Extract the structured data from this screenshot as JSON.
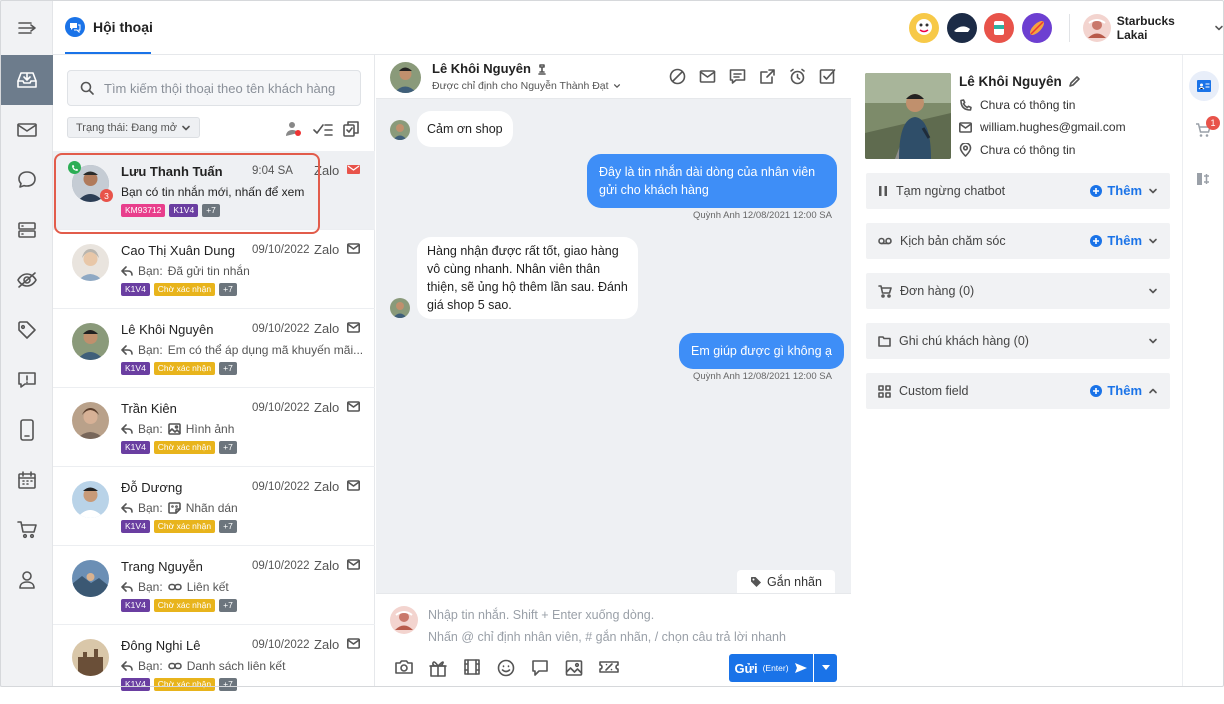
{
  "header": {
    "tab_label": "Hội thoại",
    "user_name": "Starbucks Lakai"
  },
  "search": {
    "placeholder": "Tìm kiếm thội thoại theo tên khách hàng"
  },
  "filter": {
    "label": "Trạng thái: Đang mở"
  },
  "conversations": [
    {
      "name": "Lưu Thanh Tuấn",
      "time": "9:04 SA",
      "channel": "Zalo",
      "preview": "Bạn có tin nhắn mới, nhấn để xem",
      "tags": [
        "KM93712",
        "K1V4",
        "+7"
      ],
      "badge": "3",
      "unread": true
    },
    {
      "name": "Cao Thị Xuân Dung",
      "time": "09/10/2022",
      "channel": "Zalo",
      "preview_prefix": "Bạn:",
      "preview": "Đã gửi tin nhắn",
      "tags": [
        "K1V4",
        "Chờ xác nhận",
        "+7"
      ]
    },
    {
      "name": "Lê Khôi Nguyên",
      "time": "09/10/2022",
      "channel": "Zalo",
      "preview_prefix": "Bạn:",
      "preview": "Em có thể áp dụng mã khuyến mãi...",
      "tags": [
        "K1V4",
        "Chờ xác nhận",
        "+7"
      ]
    },
    {
      "name": "Trần Kiên",
      "time": "09/10/2022",
      "channel": "Zalo",
      "preview_prefix": "Bạn:",
      "preview": "Hình ảnh",
      "tags": [
        "K1V4",
        "Chờ xác nhận",
        "+7"
      ]
    },
    {
      "name": "Đỗ Dương",
      "time": "09/10/2022",
      "channel": "Zalo",
      "preview_prefix": "Bạn:",
      "preview": "Nhãn dán",
      "tags": [
        "K1V4",
        "Chờ xác nhận",
        "+7"
      ]
    },
    {
      "name": "Trang Nguyễn",
      "time": "09/10/2022",
      "channel": "Zalo",
      "preview_prefix": "Bạn:",
      "preview": "Liên kết",
      "tags": [
        "K1V4",
        "Chờ xác nhận",
        "+7"
      ]
    },
    {
      "name": "Đông Nghi Lê",
      "time": "09/10/2022",
      "channel": "Zalo",
      "preview_prefix": "Bạn:",
      "preview": "Danh sách liên kết",
      "tags": [
        "K1V4",
        "Chờ xác nhận",
        "+7"
      ]
    }
  ],
  "chat": {
    "contact_name": "Lê Khôi Nguyên",
    "assigned": "Được chỉ định cho Nguyễn Thành Đạt",
    "messages": [
      {
        "text": "Cảm ơn shop"
      },
      {
        "text": "Đây là tin nhắn dài dòng của nhân viên gửi cho khách hàng",
        "meta": "Quỳnh Anh 12/08/2021 12:00 SA"
      },
      {
        "text": "Hàng nhận được rất tốt, giao hàng vô cùng nhanh. Nhân viên thân thiện, sẽ ủng hộ thêm lần sau. Đánh giá shop 5 sao."
      },
      {
        "text": "Em giúp được gì không ạ",
        "meta": "Quỳnh Anh 12/08/2021 12:00 SA"
      }
    ],
    "tag_button": "Gắn nhãn",
    "composer_line1": "Nhập tin nhắn. Shift + Enter xuống dòng.",
    "composer_line2": "Nhấn @ chỉ định nhân viên, # gắn nhãn, / chọn câu trả lời nhanh",
    "send_label": "Gửi",
    "send_hint": "(Enter)"
  },
  "profile": {
    "name": "Lê Khôi Nguyên",
    "phone": "Chưa có thông tin",
    "email": "william.hughes@gmail.com",
    "address": "Chưa có thông tin"
  },
  "sections": [
    {
      "label": "Tạm ngừng chatbot",
      "action": "Thêm"
    },
    {
      "label": "Kịch bản chăm sóc",
      "action": "Thêm"
    },
    {
      "label": "Đơn hàng (0)"
    },
    {
      "label": "Ghi chú khách hàng (0)"
    },
    {
      "label": "Custom field",
      "action": "Thêm"
    }
  ],
  "cart_badge": "1",
  "colors": {
    "accent": "#1a73e8",
    "bubble_out": "#3e8ef7",
    "highlight": "#e25c4b"
  }
}
